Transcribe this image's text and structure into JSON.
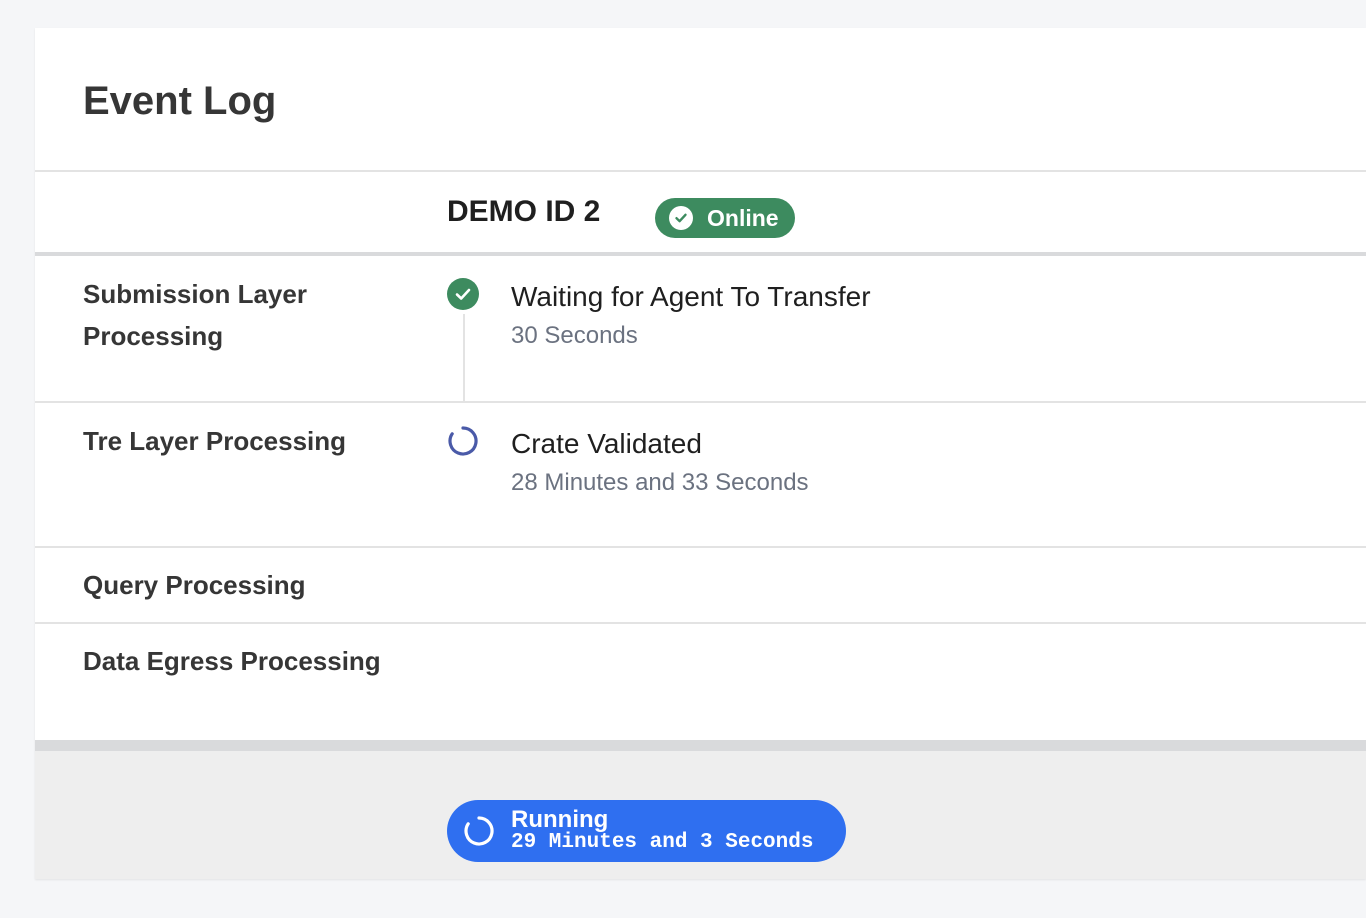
{
  "header": {
    "title": "Event Log"
  },
  "agent": {
    "name": "DEMO ID 2",
    "status_label": "Online",
    "status_icon": "check-circle-icon",
    "status_color": "#3d8b5f"
  },
  "layers": [
    {
      "label": "Submission Layer Processing",
      "event": {
        "title": "Waiting for Agent To Transfer",
        "time": "30 Seconds",
        "state": "complete",
        "icon": "check-circle-icon",
        "color": "#3d8b5f"
      }
    },
    {
      "label": "Tre Layer Processing",
      "event": {
        "title": "Crate Validated",
        "time": "28 Minutes and 33 Seconds",
        "state": "in-progress",
        "icon": "spinner-icon",
        "color": "#4a5aa8"
      }
    },
    {
      "label": "Query Processing"
    },
    {
      "label": "Data Egress Processing"
    }
  ],
  "footer": {
    "status_label": "Running",
    "duration": "29 Minutes and 3 Seconds",
    "icon": "spinner-icon",
    "color": "#2f6ff0"
  }
}
